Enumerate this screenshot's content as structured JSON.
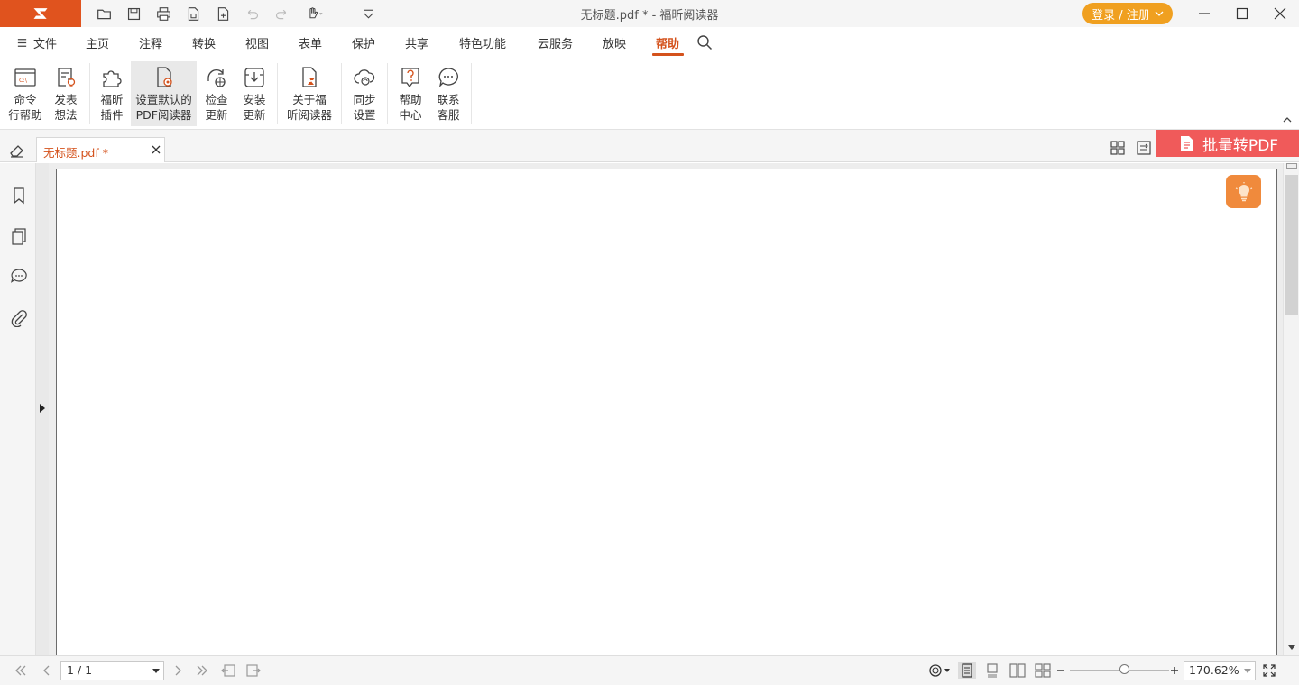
{
  "window": {
    "title": "无标题.pdf * - 福昕阅读器",
    "login_label": "登录 / 注册"
  },
  "menu": {
    "file": "文件",
    "items": [
      "主页",
      "注释",
      "转换",
      "视图",
      "表单",
      "保护",
      "共享",
      "特色功能",
      "云服务",
      "放映",
      "帮助"
    ],
    "active": "帮助"
  },
  "ribbon": {
    "buttons": [
      {
        "line1": "命令",
        "line2": "行帮助",
        "icon": "command-prompt-icon"
      },
      {
        "line1": "发表",
        "line2": "想法",
        "icon": "feedback-bulb-icon"
      },
      {
        "line1": "福昕",
        "line2": "插件",
        "icon": "puzzle-plugin-icon"
      },
      {
        "line1": "设置默认的",
        "line2": "PDF阅读器",
        "icon": "default-reader-icon"
      },
      {
        "line1": "检查",
        "line2": "更新",
        "icon": "check-update-icon"
      },
      {
        "line1": "安装",
        "line2": "更新",
        "icon": "install-update-icon"
      },
      {
        "line1": "关于福",
        "line2": "昕阅读器",
        "icon": "about-icon"
      },
      {
        "line1": "同步",
        "line2": "设置",
        "icon": "cloud-sync-icon"
      },
      {
        "line1": "帮助",
        "line2": "中心",
        "icon": "help-center-icon"
      },
      {
        "line1": "联系",
        "line2": "客服",
        "icon": "customer-service-icon"
      }
    ]
  },
  "tabs": {
    "doc_tab_label": "无标题.pdf *",
    "batch_convert_label": "批量转PDF"
  },
  "statusbar": {
    "page_value": "1 / 1",
    "zoom_value": "170.62%",
    "zoom_level": 0.55
  },
  "colors": {
    "brand": "#e0531e",
    "accent": "#d4521c",
    "login": "#f0a020",
    "batch": "#f05a5a",
    "tip": "#f08a3c"
  }
}
